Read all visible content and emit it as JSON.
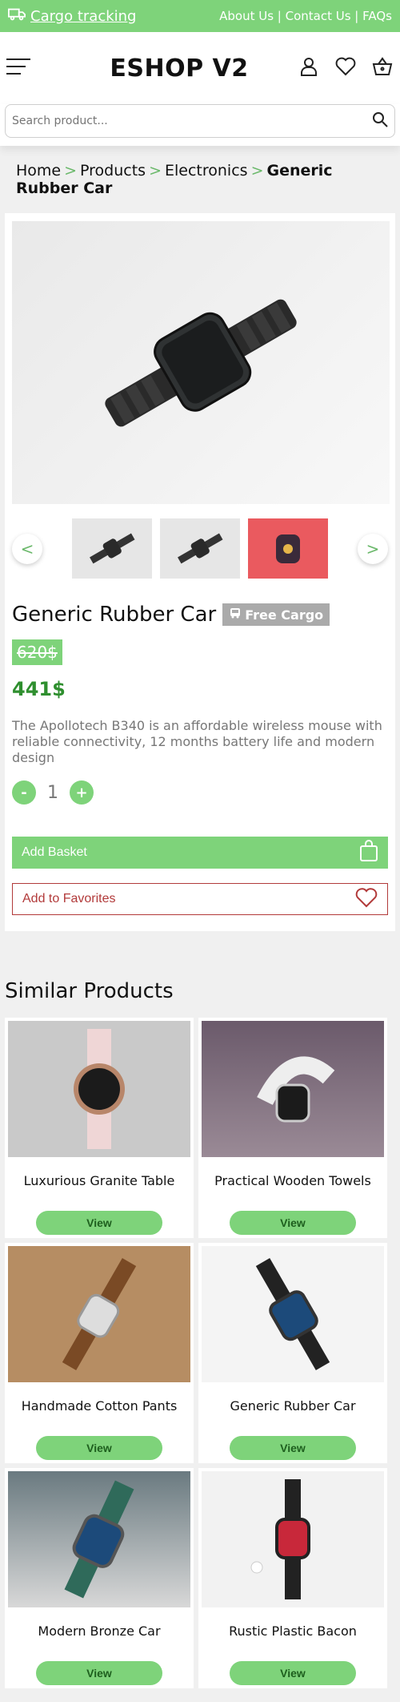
{
  "topbar": {
    "cargo_label": "Cargo tracking",
    "links_text": "About Us | Contact Us | FAQs"
  },
  "header": {
    "brand": "ESHOP V2"
  },
  "search": {
    "placeholder": "Search product..."
  },
  "breadcrumb": {
    "items": [
      "Home",
      "Products",
      "Electronics"
    ],
    "current": "Generic Rubber Car",
    "separator": ">"
  },
  "product": {
    "title": "Generic Rubber Car",
    "badge": "Free Cargo",
    "old_price": "620$",
    "new_price": "441$",
    "description": "The Apollotech B340 is an affordable wireless mouse with reliable connectivity, 12 months battery life and modern design",
    "quantity": "1",
    "qty_minus": "-",
    "qty_plus": "+",
    "add_basket": "Add Basket",
    "add_favorites": "Add to Favorites",
    "prev": "<",
    "next": ">"
  },
  "similar": {
    "title": "Similar Products",
    "view_label": "View",
    "items": [
      {
        "name": "Luxurious Granite Table"
      },
      {
        "name": "Practical Wooden Towels"
      },
      {
        "name": "Handmade Cotton Pants"
      },
      {
        "name": "Generic Rubber Car"
      },
      {
        "name": "Modern Bronze Car"
      },
      {
        "name": "Rustic Plastic Bacon"
      }
    ]
  },
  "colors": {
    "accent_green": "#7ed37a",
    "price_green": "#2f8f2f",
    "favorites_red": "#b23a3a"
  }
}
